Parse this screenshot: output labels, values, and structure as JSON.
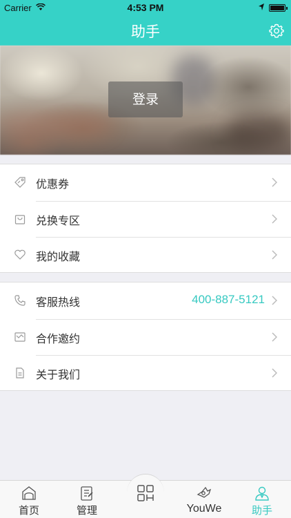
{
  "status_bar": {
    "carrier": "Carrier",
    "time": "4:53 PM"
  },
  "nav": {
    "title": "助手"
  },
  "hero": {
    "login_label": "登录"
  },
  "group1": [
    {
      "label": "优惠券",
      "icon": "coupon-icon"
    },
    {
      "label": "兑换专区",
      "icon": "shopping-bag-icon"
    },
    {
      "label": "我的收藏",
      "icon": "heart-icon"
    }
  ],
  "group2": [
    {
      "label": "客服热线",
      "icon": "phone-icon",
      "value": "400-887-5121"
    },
    {
      "label": "合作邀约",
      "icon": "envelope-icon"
    },
    {
      "label": "关于我们",
      "icon": "document-icon"
    }
  ],
  "tabs": [
    {
      "label": "首页",
      "icon": "home-icon"
    },
    {
      "label": "管理",
      "icon": "clipboard-icon"
    },
    {
      "label": "YouWe",
      "icon": "youwe-icon"
    },
    {
      "label": "助手",
      "icon": "assistant-icon",
      "active": true
    }
  ],
  "colors": {
    "accent": "#36d2c7",
    "accent_text": "#36c9c1"
  }
}
